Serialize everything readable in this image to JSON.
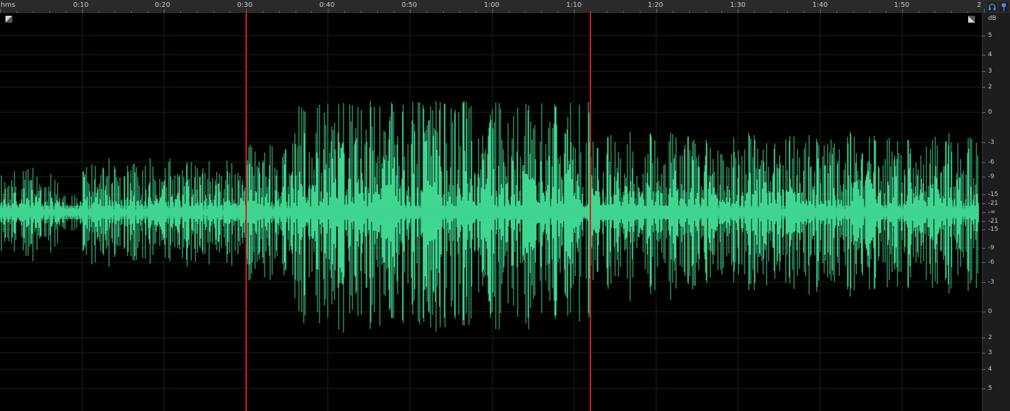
{
  "ruler": {
    "unit_label": "hms",
    "ticks": [
      "0:10",
      "0:20",
      "0:30",
      "0:40",
      "0:50",
      "1:00",
      "1:10",
      "1:20",
      "1:30",
      "1:40",
      "1:50",
      "2"
    ]
  },
  "db_scale": {
    "unit_label": "dB",
    "upper_labels": [
      "5",
      "4",
      "3",
      "2",
      "0",
      "-3",
      "-6",
      "-9",
      "-15",
      "-21"
    ],
    "center_label": "-∞",
    "lower_labels": [
      "-21",
      "-15",
      "-9",
      "-6",
      "-3",
      "0",
      "2",
      "3",
      "4",
      "5"
    ]
  },
  "markers": {
    "color": "#e01a1a",
    "times_seconds": [
      30,
      72
    ]
  },
  "waveform": {
    "color": "#3fd690",
    "duration_seconds": 120
  },
  "icons": {
    "headphone": "headphone-icon",
    "pin": "pin-icon",
    "zoom_left": "zoom-corner-icon",
    "zoom_right": "zoom-corner-icon"
  }
}
